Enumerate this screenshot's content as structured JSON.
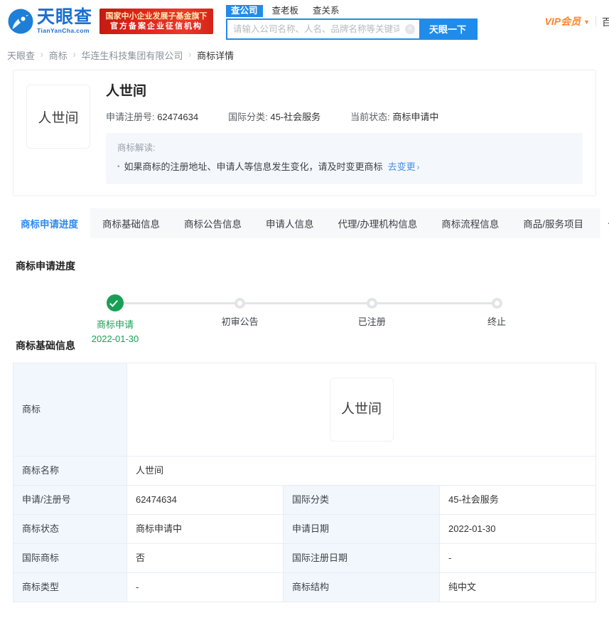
{
  "header": {
    "logo": {
      "cn": "天眼查",
      "en": "TianYanCha.com"
    },
    "gov_badge": {
      "line1": "国家中小企业发展子基金旗下",
      "line2": "官方备案企业征信机构"
    },
    "search_tabs": [
      {
        "label": "查公司",
        "active": true
      },
      {
        "label": "查老板",
        "active": false
      },
      {
        "label": "查关系",
        "active": false
      }
    ],
    "search": {
      "value": "",
      "placeholder": "请输入公司名称、人名、品牌名称等关键词",
      "clear": "×"
    },
    "search_button": "天眼一下",
    "vip": "VIP会员",
    "vip_caret": "▼",
    "extra": "百"
  },
  "breadcrumb": [
    {
      "label": "天眼查",
      "current": false
    },
    {
      "label": "商标",
      "current": false
    },
    {
      "label": "华连生科技集团有限公司",
      "current": false
    },
    {
      "label": "商标详情",
      "current": true
    }
  ],
  "breadcrumb_separator": "›",
  "detail": {
    "thumb_text": "人世间",
    "title": "人世间",
    "meta": [
      {
        "label": "申请注册号:",
        "value": "62474634"
      },
      {
        "label": "国际分类:",
        "value": "45-社会服务"
      },
      {
        "label": "当前状态:",
        "value": "商标申请中"
      }
    ],
    "notice_title": "商标解读:",
    "notice_bullet": "▪",
    "notice_text": "如果商标的注册地址、申请人等信息发生变化，请及时变更商标",
    "notice_link": "去变更",
    "notice_link_arrow": "›"
  },
  "tabs": [
    {
      "label": "商标申请进度",
      "active": true
    },
    {
      "label": "商标基础信息",
      "active": false
    },
    {
      "label": "商标公告信息",
      "active": false
    },
    {
      "label": "申请人信息",
      "active": false
    },
    {
      "label": "代理/办理机构信息",
      "active": false
    },
    {
      "label": "商标流程信息",
      "active": false
    },
    {
      "label": "商品/服务项目",
      "active": false
    },
    {
      "label": "公告信息",
      "active": false
    }
  ],
  "progress": {
    "section_title": "商标申请进度",
    "steps": [
      {
        "label": "商标申请",
        "date": "2022-01-30",
        "done": true
      },
      {
        "label": "初审公告",
        "date": "",
        "done": false
      },
      {
        "label": "已注册",
        "date": "",
        "done": false
      },
      {
        "label": "终止",
        "date": "",
        "done": false
      }
    ]
  },
  "basic_info": {
    "section_title": "商标基础信息",
    "logo_row": {
      "label": "商标",
      "image_text": "人世间"
    },
    "name_row": {
      "label": "商标名称",
      "value": "人世间"
    },
    "rows": [
      {
        "k1": "申请/注册号",
        "v1": "62474634",
        "k2": "国际分类",
        "v2": "45-社会服务"
      },
      {
        "k1": "商标状态",
        "v1": "商标申请中",
        "k2": "申请日期",
        "v2": "2022-01-30"
      },
      {
        "k1": "国际商标",
        "v1": "否",
        "k2": "国际注册日期",
        "v2": "-"
      },
      {
        "k1": "商标类型",
        "v1": "-",
        "k2": "商标结构",
        "v2": "纯中文"
      }
    ]
  },
  "colors": {
    "brand_blue": "#1f8ceb",
    "link_blue": "#4a8fe0",
    "accent_orange": "#ff8430",
    "badge_red": "#e0241a",
    "success_green": "#17a055"
  }
}
